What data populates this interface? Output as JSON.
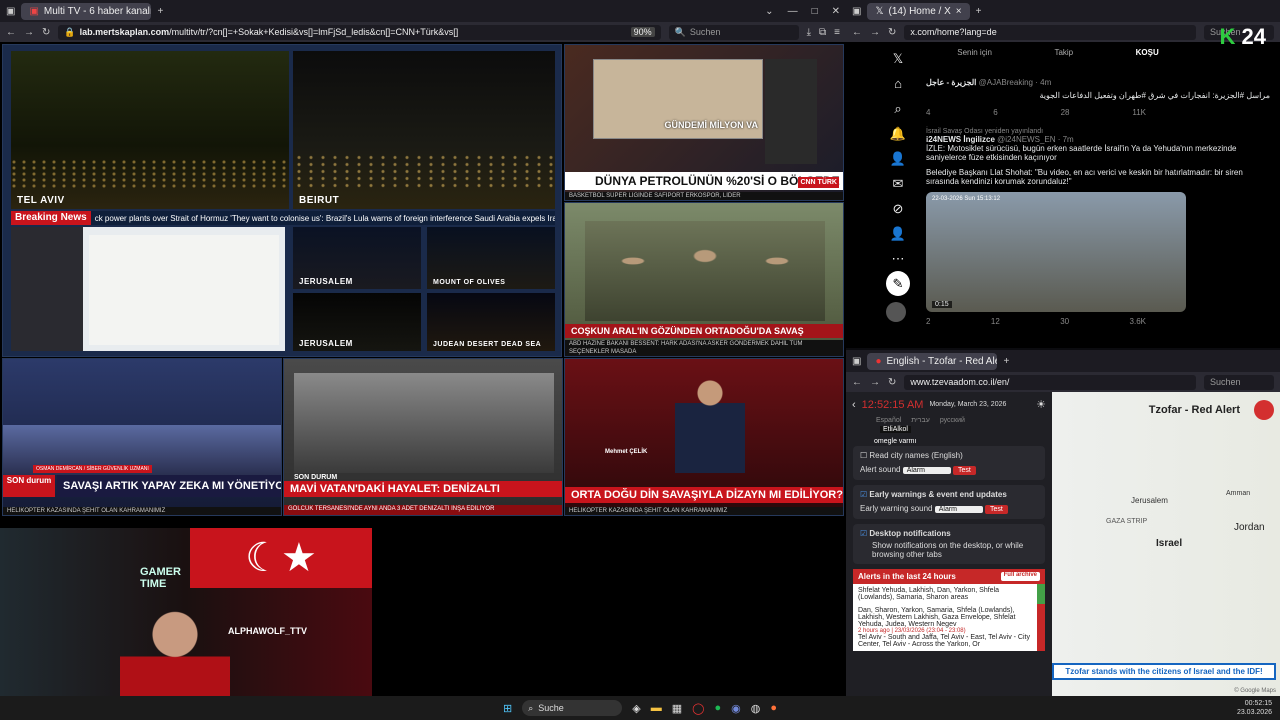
{
  "left_browser": {
    "tab_title": "Multi TV - 6 haber kanalını aynı",
    "url_host": "lab.mertskaplan.com",
    "url_path": "/multitv/tr/?cn[]=+Sokak+Kedisi&vs[]=lmFjSd_ledis&cn[]=CNN+Türk&vs[]",
    "zoom": "90%",
    "search_placeholder": "Suchen"
  },
  "tiles": {
    "tel_aviv": "TEL AVIV",
    "beirut": "BEIRUT",
    "breaking_label": "Breaking News",
    "breaking_text": "ck power plants over Strait of Hormuz   'They want to colonise us': Brazil's Lula warns of foreign interference   Saudi Arabia expels Iran military attache, four emb",
    "jerusalem1": "JERUSALEM",
    "mount_olives": "MOUNT OF OLIVES",
    "jerusalem2": "JERUSALEM",
    "judean": "JUDEAN DESERT DEAD SEA",
    "cnn_headline": "DÜNYA PETROLÜNÜN %20'Sİ O BÖLGEDE",
    "cnn_logo": "CNN TÜRK",
    "cnn_ticker": "BASKETBOL SÜPER LİGİNDE SAFİPORT ERKOSPOR, LİDER",
    "cnn_map_title": "GÜNDEMİ MİLYON VA",
    "tile6_headline": "COŞKUN ARAL'IN GÖZÜNDEN ORTADOĞU'DA SAVAŞ",
    "tile6_ticker": "ABD HAZİNE BAKANI BESSENT: HARK ADASI'NA ASKER GÖNDERMEK DAHİL TÜM SEÇENEKLER MASADA",
    "habertürk_badge": "SON durum",
    "habertürk_headline": "SAVAŞI ARTIK YAPAY ZEKA MI YÖNETİYOR?",
    "habertürk_guest": "OSMAN DEMİRCAN / SİBER GÜVENLİK UZMANI",
    "haberglobal_label": "SON DURUM",
    "haberglobal_headline": "MAVİ VATAN'DAKİ HAYALET: DENİZALTI",
    "haberglobal_sub": "GÖLCÜK TERSANESİ'NDE AYNI ANDA 3 ADET DENİZALTI İNŞA EDİLİYOR",
    "a_haber_name": "Mehmet ÇELİK",
    "a_haber_headline": "ORTA DOĞU DİN SAVAŞIYLA DİZAYN MI EDİLİYOR?",
    "a_haber_ticker": "HELİKOPTER KAZASINDA ŞEHİT OLAN KAHRAMANIMIZ"
  },
  "x_browser": {
    "tab_title": "(14) Home / X",
    "url": "x.com/home?lang=de",
    "search_placeholder": "Suchen",
    "tabs": [
      "Senin için",
      "Takip",
      "KOŞU"
    ],
    "notif_count": "14",
    "tweet1_name": "الجزيرة - عاجل",
    "tweet1_handle": "@AJABreaking · 4m",
    "tweet1_text": "مراسل #الجزيرة: انفجارات في شرق #طهران وتفعيل الدفاعات الجوية",
    "tweet1_stats": [
      "4",
      "6",
      "28",
      "11K"
    ],
    "retweet_note": "İsrail Savaş Odası yeniden yayınlandı",
    "tweet2_name": "i24NEWS İngilizce",
    "tweet2_handle": "@i24NEWS_EN · 7m",
    "tweet2_text": "İZLE: Motosiklet sürücüsü, bugün erken saatlerde İsrail'in Ya da Yehuda'nın merkezinde saniyelerce füze etkisinden kaçınıyor",
    "tweet2_quote": "Belediye Başkanı Llat Shohat: \"Bu video, en acı verici ve keskin bir hatırlatmadır: bir siren sırasında kendinizi korumak zorundaluz!\"",
    "video_time": "0:15",
    "video_stamp": "22-03-2026 Sun 15:13:12",
    "tweet2_stats": [
      "2",
      "12",
      "30",
      "3.6K"
    ],
    "logo_24": "24"
  },
  "alert_browser": {
    "tab_title": "English - Tzofar - Red Alert",
    "url": "www.tzevaadom.co.il/en/",
    "search_placeholder": "Suchen",
    "clock": "12:52:15 AM",
    "date": "Monday, March 23, 2026",
    "etti": "EtliAlkol",
    "omegle": "omegle varmı",
    "langs": [
      "Español",
      "עברית",
      "русский"
    ],
    "read_names": "Read city names (English)",
    "alert_sound_label": "Alert sound",
    "alert_sound_value": "Alarm",
    "test": "Test",
    "early_title": "Early warnings & event end updates",
    "early_sound_label": "Early warning sound",
    "desktop_title": "Desktop notifications",
    "desktop_text": "Show notifications on the desktop, or while browsing other tabs",
    "alerts_title": "Alerts in the last 24 hours",
    "full_archive": "Full archive",
    "alert1": "Shfelat Yehuda, Lakhish, Dan, Yarkon, Shfela (Lowlands), Samaria, Sharon areas",
    "alert2": "Dan, Sharon, Yarkon, Samaria, Shfela (Lowlands), Lakhish, Western Lakhish, Gaza Envelope, Shfelat Yehuda, Judea, Western Negev",
    "alert2_time": "2 hours ago | 23/03/2026 (23:04 - 23:08)",
    "alert3": "Tel Aviv - South and Jaffa, Tel Aviv - East, Tel Aviv - City Center, Tel Aviv - Across the Yarkon, Or",
    "map_title": "Tzofar - Red Alert",
    "map_labels": [
      "Jerusalem",
      "Israel",
      "Jordan",
      "GAZA STRIP",
      "Amman"
    ],
    "banner": "Tzofar stands with the citizens of Israel and the IDF!",
    "google": "© Google Maps"
  },
  "webcam": {
    "sign": "GAMER TIME",
    "name": "ALPHAWOLF_TTV"
  },
  "taskbar": {
    "search": "Suche",
    "time": "00:52:15",
    "date": "23.03.2026"
  }
}
